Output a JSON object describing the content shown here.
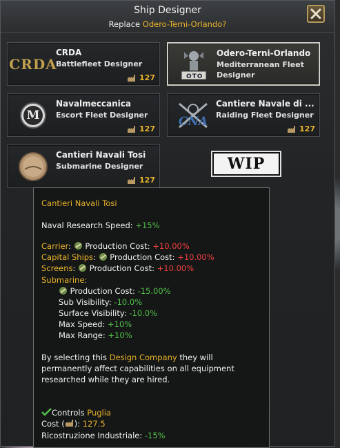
{
  "window": {
    "title": "Ship Designer",
    "subtitle_prefix": "Replace ",
    "subtitle_target": "Odero-Terni-Orlando?"
  },
  "cards": [
    {
      "name": "CRDA",
      "role": "Battlefleet Designer",
      "cost": "127",
      "logo_text": "CRDA"
    },
    {
      "name": "Odero-Terni-Orlando",
      "role": "Mediterranean Fleet Designer",
      "cost": "",
      "logo_text": "OTO"
    },
    {
      "name": "Navalmeccanica",
      "role": "Escort Fleet Designer",
      "cost": "127",
      "logo_text": "M"
    },
    {
      "name": "Cantiere Navale di ...",
      "role": "Raiding Fleet Designer",
      "cost": "127",
      "logo_text": "CNA"
    },
    {
      "name": "Cantieri Navali Tosi",
      "role": "Submarine Designer",
      "cost": "127",
      "logo_text": ""
    }
  ],
  "wip_label": "WIP",
  "tooltip": {
    "title": "Cantieri Navali Tosi",
    "research_label": "Naval Research Speed: ",
    "research_value": "+15%",
    "carrier_label": "Carrier",
    "capital_label": "Capital Ships",
    "screens_label": "Screens",
    "production_cost_label": " Production Cost:  ",
    "carrier_value": "+10.00%",
    "capital_value": "+10.00%",
    "screens_value": "+10.00%",
    "submarine_label": "Submarine:",
    "sub_prod_label": " Production Cost:  ",
    "sub_prod_value": "-15.00%",
    "sub_vis_label": "Sub Visibility:  ",
    "sub_vis_value": "-10.0%",
    "surf_vis_label": "Surface Visibility:  ",
    "surf_vis_value": "-10.0%",
    "max_speed_label": "Max Speed: ",
    "max_speed_value": "+10%",
    "max_range_label": "Max Range: ",
    "max_range_value": "+10%",
    "desc_1_a": "By selecting this ",
    "desc_1_b": "Design Company",
    "desc_1_c": " they will",
    "desc_2": "permanently affect capabilities on all equipment",
    "desc_3": "researched while they are hired.",
    "controls_label": "Controls ",
    "controls_value": "Puglia",
    "cost_label_a": "Cost (",
    "cost_label_b": "): ",
    "cost_value": "127.5",
    "ricostruzione_label": "Ricostruzione Industriale: ",
    "ricostruzione_value": "-15%"
  },
  "colors": {
    "gold": "#e8b42a",
    "green": "#52c24a",
    "red": "#f04040"
  }
}
